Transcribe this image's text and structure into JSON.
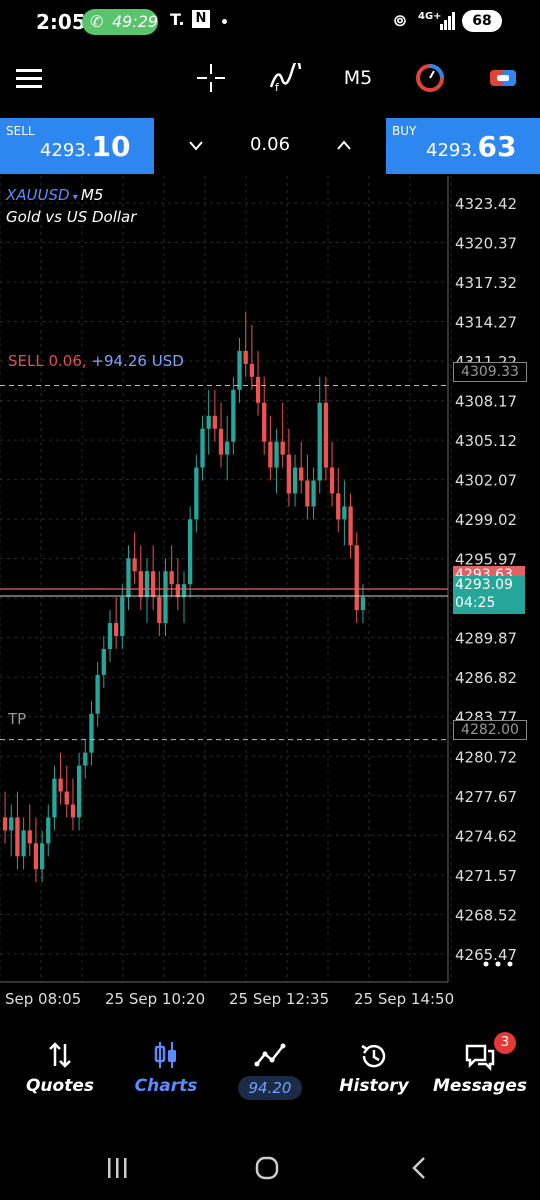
{
  "status_bar": {
    "time": "2:05",
    "call_duration": "49:29",
    "app_icons": [
      "T.",
      "N"
    ],
    "network": "4G+",
    "battery": "68"
  },
  "toolbar": {
    "timeframe": "M5",
    "icons": [
      "menu-icon",
      "crosshair-icon",
      "indicators-icon",
      "timeframe-label",
      "trade-icon",
      "account-icon"
    ]
  },
  "trade_bar": {
    "sell_label": "SELL",
    "sell_price_main": "4293.",
    "sell_price_big": "10",
    "buy_label": "BUY",
    "buy_price_main": "4293.",
    "buy_price_big": "63",
    "volume": "0.06"
  },
  "chart_data": {
    "type": "candlestick",
    "symbol": "XAUUSD",
    "timeframe": "M5",
    "description": "Gold vs US Dollar",
    "position_label": "SELL 0.06,",
    "position_profit": "+94.26 USD",
    "position_price": "4309.33",
    "tp_label": "TP",
    "tp_price": "4282.00",
    "bid_price": "4293.09",
    "countdown": "04:25",
    "ask_label_partial": "4293.63",
    "y_ticks": [
      "4323.42",
      "4320.37",
      "4317.32",
      "4314.27",
      "4311.22",
      "4308.17",
      "4305.12",
      "4302.07",
      "4299.02",
      "4295.97",
      "4292.92",
      "4289.87",
      "4286.82",
      "4283.77",
      "4280.72",
      "4277.67",
      "4274.62",
      "4271.57",
      "4268.52",
      "4265.47"
    ],
    "ylim": [
      4263.3,
      4325.5
    ],
    "x_ticks": [
      "Sep 08:05",
      "25 Sep 10:20",
      "25 Sep 12:35",
      "25 Sep 14:50"
    ],
    "ohlc": [
      [
        4276,
        4278,
        4274,
        4275
      ],
      [
        4275,
        4277,
        4273,
        4276
      ],
      [
        4276,
        4278,
        4272,
        4273
      ],
      [
        4273,
        4276,
        4272,
        4275
      ],
      [
        4275,
        4277,
        4273,
        4274
      ],
      [
        4274,
        4276,
        4271,
        4272
      ],
      [
        4272,
        4275,
        4271,
        4274
      ],
      [
        4274,
        4277,
        4273,
        4276
      ],
      [
        4276,
        4280,
        4275,
        4279
      ],
      [
        4279,
        4281,
        4277,
        4278
      ],
      [
        4278,
        4280,
        4276,
        4277
      ],
      [
        4277,
        4279,
        4275,
        4276
      ],
      [
        4276,
        4281,
        4275,
        4280
      ],
      [
        4280,
        4282,
        4279,
        4281
      ],
      [
        4281,
        4285,
        4280,
        4284
      ],
      [
        4284,
        4288,
        4283,
        4287
      ],
      [
        4287,
        4290,
        4286,
        4289
      ],
      [
        4289,
        4292,
        4288,
        4291
      ],
      [
        4291,
        4293,
        4289,
        4290
      ],
      [
        4290,
        4294,
        4289,
        4293
      ],
      [
        4293,
        4297,
        4292,
        4296
      ],
      [
        4296,
        4298,
        4294,
        4295
      ],
      [
        4295,
        4297,
        4292,
        4293
      ],
      [
        4293,
        4296,
        4291,
        4295
      ],
      [
        4295,
        4297,
        4292,
        4293
      ],
      [
        4293,
        4295,
        4290,
        4291
      ],
      [
        4291,
        4296,
        4290,
        4295
      ],
      [
        4295,
        4297,
        4293,
        4294
      ],
      [
        4294,
        4296,
        4292,
        4293
      ],
      [
        4293,
        4295,
        4291,
        4294
      ],
      [
        4294,
        4300,
        4293,
        4299
      ],
      [
        4299,
        4304,
        4298,
        4303
      ],
      [
        4303,
        4307,
        4302,
        4306
      ],
      [
        4306,
        4309,
        4304,
        4307
      ],
      [
        4307,
        4309,
        4305,
        4306
      ],
      [
        4306,
        4308,
        4303,
        4304
      ],
      [
        4304,
        4307,
        4302,
        4305
      ],
      [
        4305,
        4310,
        4304,
        4309
      ],
      [
        4309,
        4313,
        4308,
        4312
      ],
      [
        4312,
        4315,
        4310,
        4311
      ],
      [
        4311,
        4314,
        4309,
        4310
      ],
      [
        4310,
        4312,
        4307,
        4308
      ],
      [
        4308,
        4310,
        4304,
        4305
      ],
      [
        4305,
        4307,
        4302,
        4303
      ],
      [
        4303,
        4306,
        4301,
        4305
      ],
      [
        4305,
        4308,
        4303,
        4304
      ],
      [
        4304,
        4306,
        4300,
        4301
      ],
      [
        4301,
        4304,
        4300,
        4303
      ],
      [
        4303,
        4305,
        4301,
        4302
      ],
      [
        4302,
        4304,
        4299,
        4300
      ],
      [
        4300,
        4303,
        4299,
        4302
      ],
      [
        4302,
        4310,
        4301,
        4308
      ],
      [
        4308,
        4310,
        4302,
        4303
      ],
      [
        4303,
        4305,
        4300,
        4301
      ],
      [
        4301,
        4303,
        4298,
        4299
      ],
      [
        4299,
        4302,
        4297,
        4300
      ],
      [
        4300,
        4301,
        4296,
        4297
      ],
      [
        4297,
        4298,
        4291,
        4292
      ],
      [
        4292,
        4294,
        4291,
        4293
      ]
    ]
  },
  "nav": {
    "quotes": "Quotes",
    "charts": "Charts",
    "trade_value": "94.20",
    "history": "History",
    "messages": "Messages",
    "messages_badge": "3"
  }
}
